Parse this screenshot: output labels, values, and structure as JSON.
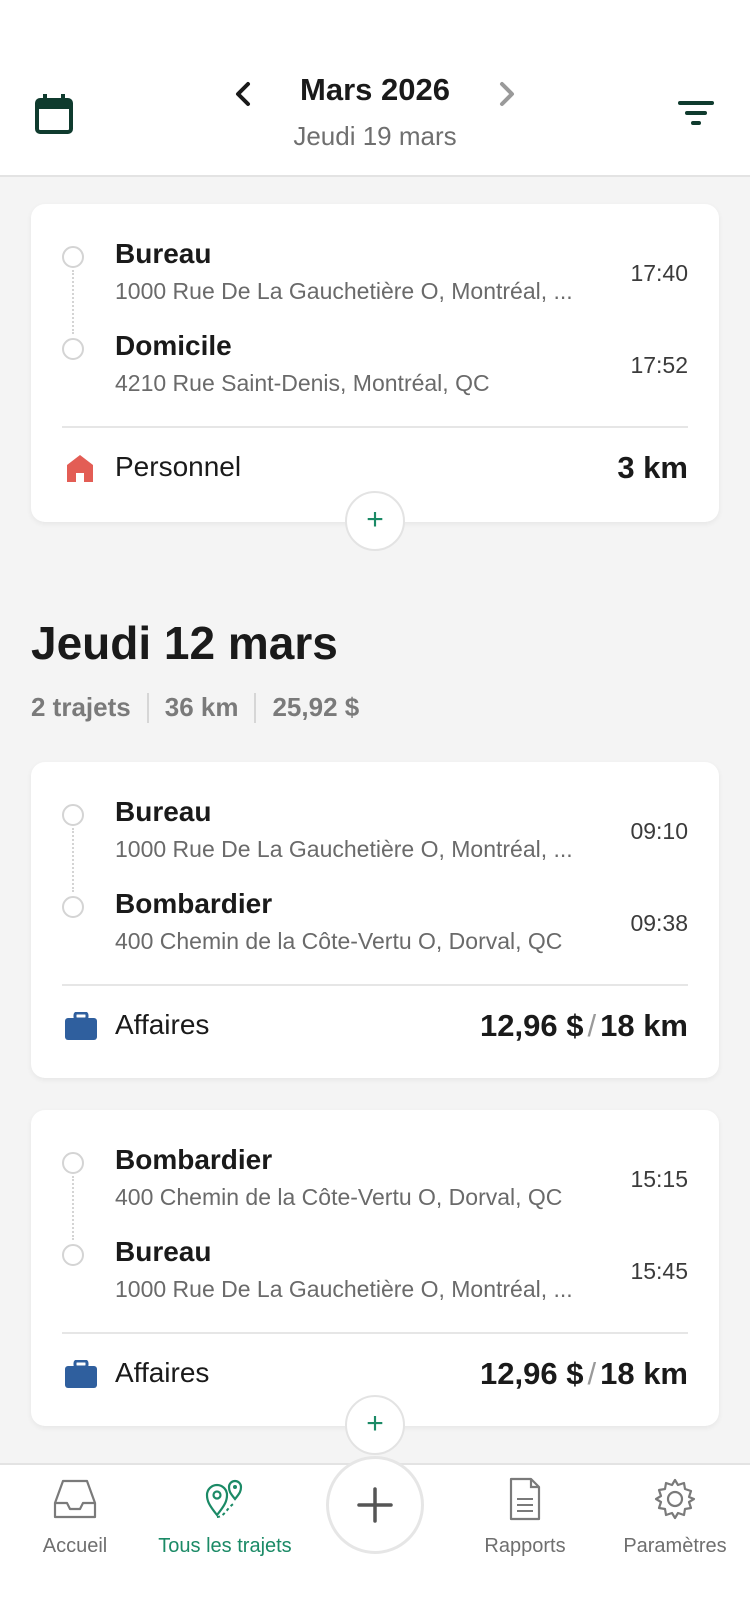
{
  "header": {
    "month_title": "Mars 2026",
    "day_subtitle": "Jeudi 19 mars",
    "icons": [
      "calendar-icon",
      "chevron-left-icon",
      "chevron-right-icon",
      "filter-icon"
    ]
  },
  "colors": {
    "accent": "#1b8a66",
    "personal": "#e35d55",
    "business": "#2f5f9e",
    "dark_green": "#0f3b2e"
  },
  "trips_today": [
    {
      "from": {
        "name": "Bureau",
        "address": "1000 Rue De La Gauchetière O, Montréal, ...",
        "time": "17:40"
      },
      "to": {
        "name": "Domicile",
        "address": "4210 Rue Saint-Denis, Montréal, QC",
        "time": "17:52"
      },
      "category": "Personnel",
      "category_icon": "home-icon",
      "distance": "3 km"
    }
  ],
  "day_section": {
    "title": "Jeudi 12 mars",
    "stats": [
      "2 trajets",
      "36 km",
      "25,92 $"
    ]
  },
  "trips": [
    {
      "from": {
        "name": "Bureau",
        "address": "1000 Rue De La Gauchetière O, Montréal, ...",
        "time": "09:10"
      },
      "to": {
        "name": "Bombardier",
        "address": "400 Chemin de la Côte-Vertu O, Dorval, QC",
        "time": "09:38"
      },
      "category": "Affaires",
      "category_icon": "briefcase-icon",
      "amount": "12,96 $",
      "separator": "/",
      "distance": "18 km"
    },
    {
      "from": {
        "name": "Bombardier",
        "address": "400 Chemin de la Côte-Vertu O, Dorval, QC",
        "time": "15:15"
      },
      "to": {
        "name": "Bureau",
        "address": "1000 Rue De La Gauchetière O, Montréal, ...",
        "time": "15:45"
      },
      "category": "Affaires",
      "category_icon": "briefcase-icon",
      "amount": "12,96 $",
      "separator": "/",
      "distance": "18 km"
    }
  ],
  "add_glyph": "+",
  "nav": {
    "items": [
      {
        "label": "Accueil",
        "icon": "inbox-icon",
        "active": false
      },
      {
        "label": "Tous les trajets",
        "icon": "map-pins-icon",
        "active": true
      },
      {
        "label": "Rapports",
        "icon": "document-icon",
        "active": false
      },
      {
        "label": "Paramètres",
        "icon": "gear-icon",
        "active": false
      }
    ],
    "fab_icon": "plus-icon"
  }
}
